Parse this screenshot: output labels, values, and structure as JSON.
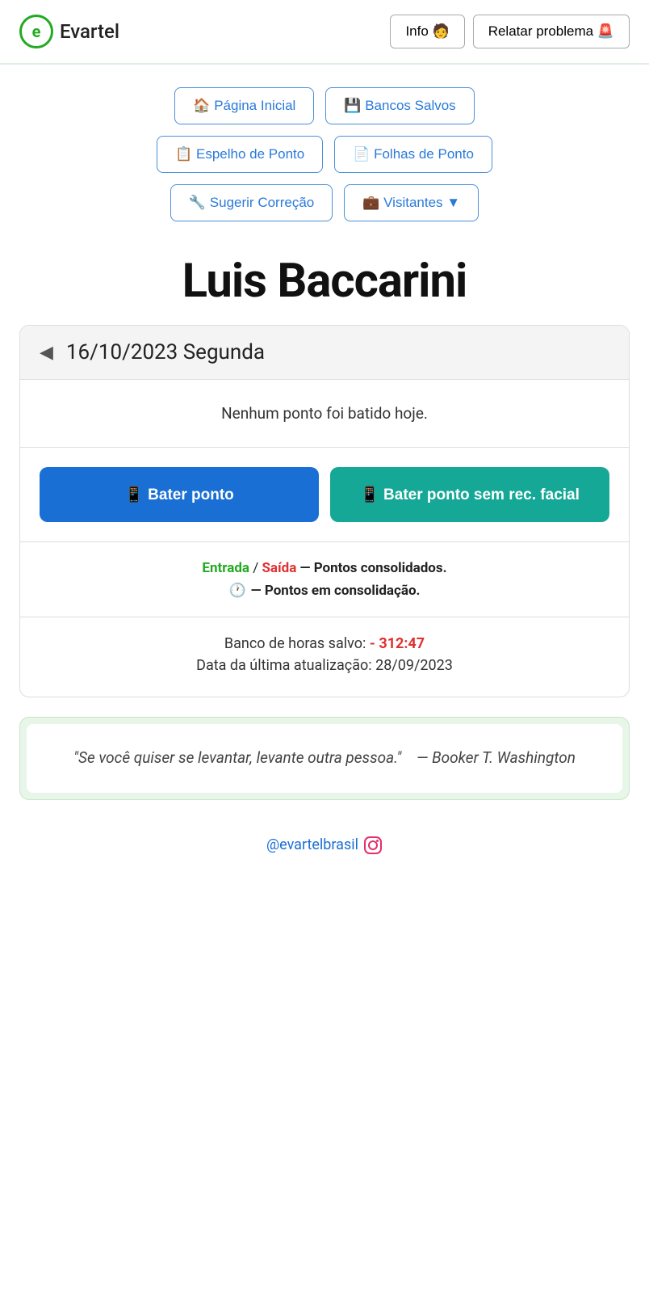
{
  "header": {
    "logo_letter": "e",
    "logo_name": "Evartel",
    "info_button": "Info 🧑",
    "report_button": "Relatar problema 🚨"
  },
  "nav": {
    "row1": [
      {
        "label": "🏠 Página Inicial",
        "name": "nav-pagina-inicial"
      },
      {
        "label": "💾 Bancos Salvos",
        "name": "nav-bancos-salvos"
      }
    ],
    "row2": [
      {
        "label": "📋 Espelho de Ponto",
        "name": "nav-espelho-ponto"
      },
      {
        "label": "📄 Folhas de Ponto",
        "name": "nav-folhas-ponto"
      }
    ],
    "row3": [
      {
        "label": "🔧 Sugerir Correção",
        "name": "nav-sugerir-correcao"
      },
      {
        "label": "💼 Visitantes ▼",
        "name": "nav-visitantes"
      }
    ]
  },
  "user": {
    "name": "Luis Baccarini"
  },
  "date_section": {
    "arrow": "◀",
    "date_text": "16/10/2023 Segunda"
  },
  "status": {
    "no_points": "Nenhum ponto foi batido hoje."
  },
  "buttons": {
    "bater_ponto": "📱 Bater ponto",
    "bater_sem_facial": "📱 Bater ponto sem rec. facial"
  },
  "legend": {
    "entrada": "Entrada",
    "separator": " / ",
    "saida": "Saída",
    "consolidados": "— Pontos consolidados.",
    "clock_emoji": "🕐",
    "consolidando": "— Pontos em consolidação."
  },
  "bank": {
    "label": "Banco de horas salvo: ",
    "hours": "- 312:47",
    "update_label": "Data da última atualização: 28/09/2023"
  },
  "quote": {
    "text": "\"Se você quiser se levantar, levante outra pessoa.\"",
    "author": "— Booker T. Washington"
  },
  "footer": {
    "instagram_handle": "@evartelbrasil",
    "instagram_url": "#"
  }
}
